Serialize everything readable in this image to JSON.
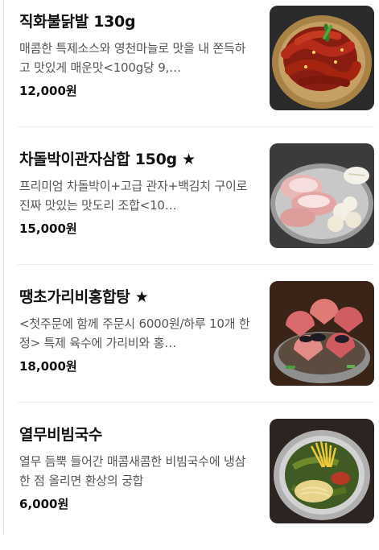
{
  "menu": {
    "items": [
      {
        "name": "직화불닭발 130g",
        "description": "매콤한 특제소스와 영천마늘로 맛을 내 쫀득하고 맛있게 매운맛<100g당 9,…",
        "price": "12,000원",
        "image_icon": "spicy-chicken-feet-photo"
      },
      {
        "name": "차돌박이관자삼합 150g ★",
        "description": "프리미엄 차돌박이+고급 관자+백김치 구이로 진짜 맛있는 맛도리 조합<10…",
        "price": "15,000원",
        "image_icon": "brisket-scallop-platter-photo"
      },
      {
        "name": "땡초가리비홍합탕 ★",
        "description": "<첫주문에 함께 주문시 6000원/하루 10개 한정> 특제 육수에 가리비와 홍…",
        "price": "18,000원",
        "image_icon": "scallop-mussel-soup-photo"
      },
      {
        "name": "열무비빔국수",
        "description": "열무 듬뿍 들어간 매콤새콤한 비빔국수에 냉삼 한 점 올리면 환상의 궁합",
        "price": "6,000원",
        "image_icon": "yeolmu-bibim-noodles-photo"
      }
    ]
  }
}
